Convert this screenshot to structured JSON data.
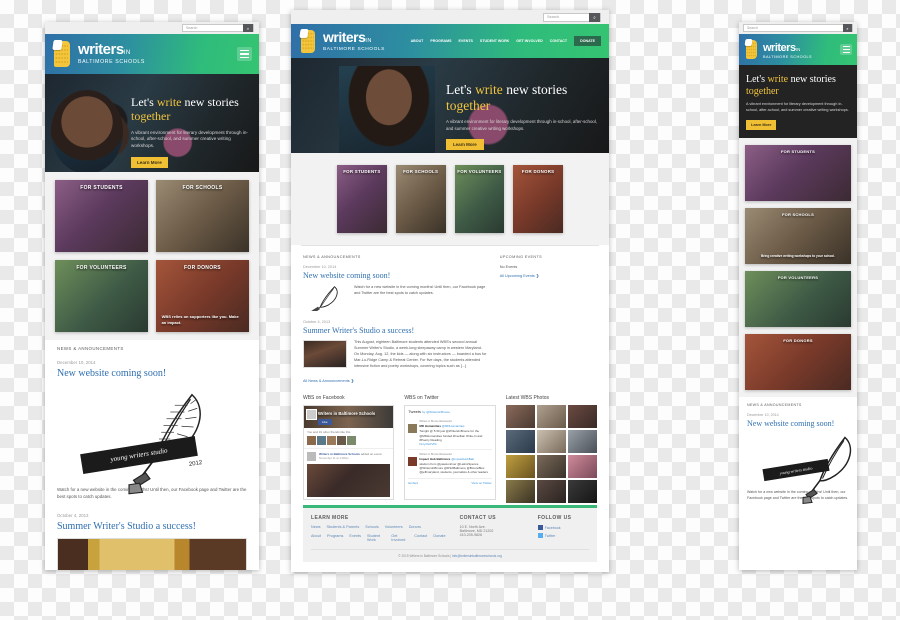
{
  "site": {
    "brand": {
      "word": "writers",
      "in": "IN",
      "sub": "BALTIMORE SCHOOLS",
      "logo_icon": "book-icon"
    },
    "search": {
      "placeholder": "Search",
      "value": "",
      "button_icon": "search-icon"
    },
    "nav": [
      {
        "label": "ABOUT",
        "caret": "▾"
      },
      {
        "label": "PROGRAMS",
        "caret": "▾"
      },
      {
        "label": "EVENTS",
        "caret": "▾"
      },
      {
        "label": "STUDENT WORK",
        "caret": ""
      },
      {
        "label": "GET INVOLVED",
        "caret": "▾"
      },
      {
        "label": "CONTACT",
        "caret": ""
      }
    ],
    "donate": "DONATE",
    "menu_icon": "hamburger-icon"
  },
  "hero": {
    "title_1": "Let's ",
    "title_2": "write",
    "title_3": " new stories ",
    "title_4": "together",
    "subtitle": "A vibrant environment for literary development through in-school, after-school, and summer creative writing workshops.",
    "cta": "Learn More"
  },
  "cards": [
    {
      "title": "FOR STUDENTS",
      "sub": ""
    },
    {
      "title": "FOR SCHOOLS",
      "sub": "Bring creative writing workshops to your school."
    },
    {
      "title": "FOR VOLUNTEERS",
      "sub": ""
    },
    {
      "title": "FOR DONORS",
      "sub": "WBS relies on supporters like you. Make an impact."
    }
  ],
  "news": {
    "heading": "NEWS & ANNOUNCEMENTS",
    "items": [
      {
        "date": "December 10, 2014",
        "title": "New website coming soon!",
        "body": "Watch for a new website in the coming months! Until then, our Facebook page and Twitter are the best spots to catch updates.",
        "thumb": "quill-illustration"
      },
      {
        "date": "October 4, 2013",
        "title": "Summer Writer's Studio a success!",
        "body": "This August, eighteen Baltimore students attended WBS's second annual Summer Writer's Studio, a week-long sleepaway camp in western Maryland. On Monday, Aug. 12, the kids — along with six instructors — boarded a bus for Mar-Lu-Ridge Camp & Retreat Center. For five days, the students attended intensive fiction and poetry workshops, covering topics such as [...]",
        "thumb": "group-photo"
      }
    ],
    "all_link": "All News & Announcements ❯"
  },
  "events": {
    "heading": "UPCOMING EVENTS",
    "empty": "No Events",
    "all_link": "All Upcoming Events ❯"
  },
  "social": {
    "facebook": {
      "heading": "WBS on Facebook",
      "page_name": "Writers in Baltimore Schools",
      "like_label": "Like",
      "followers": "You and 19 other friends like this",
      "post_author": "Writers in Baltimore Schools",
      "post_meta": "added an event.",
      "post_date": "November 11 at 1:08pm"
    },
    "twitter": {
      "heading": "WBS on Twitter",
      "tweets_label": "Tweets",
      "by_label": "by @WritersInBmore",
      "items": [
        {
          "retweet": "Writers in Bmore Retweeted",
          "name": "MD Humanities",
          "handle": "@MDHumanities",
          "text": "Tonight @ 5:30 just @WritersInBmore for the @MDHumanities funded #Cecilian Write-In and #Poetry Reading",
          "link": "bit.ly/2eFVDt"
        },
        {
          "retweet": "Writers in Bmore Retweeted",
          "name": "Impact Hub Baltimore",
          "handle": "@ImpactHubBalt",
          "text": "wisdom from @passionriver @LatinxSpence @WritersInBmore @DSABaltimore @BmoreBloc @jeffmaryland, students, journalists & other leaders",
          "link": ""
        }
      ],
      "embed_label": "Embed",
      "view_label": "View on Twitter"
    },
    "photos": {
      "heading": "Latest WBS Photos",
      "count": 12
    }
  },
  "footer": {
    "learn_more": {
      "heading": "LEARN MORE",
      "row1": [
        "News",
        "Students & Parents",
        "Schools",
        "Volunteers",
        "Donors"
      ],
      "row2": [
        "About",
        "Programs",
        "Events",
        "Student Work",
        "Get Involved",
        "Contact",
        "Donate"
      ]
    },
    "contact": {
      "heading": "CONTACT US",
      "lines": [
        "10 E. North Ave.",
        "Baltimore, MD 21202",
        "410-205-9826"
      ]
    },
    "follow": {
      "heading": "FOLLOW US",
      "items": [
        {
          "label": "Facebook",
          "icon": "facebook-icon",
          "color": "#3b5998"
        },
        {
          "label": "Twitter",
          "icon": "twitter-icon",
          "color": "#55acee"
        }
      ]
    },
    "copyright": "© 2015 Writers in Baltimore Schools",
    "email": "info@writersinbaltimoreschools.org"
  },
  "quill": {
    "ribbon_text": "young writers studio",
    "year": "2012"
  },
  "colors": {
    "accent_yellow": "#f0bf33",
    "link_blue": "#2f6fb0",
    "green": "#35c471",
    "blue": "#2f6fa8",
    "dark": "#232323"
  }
}
